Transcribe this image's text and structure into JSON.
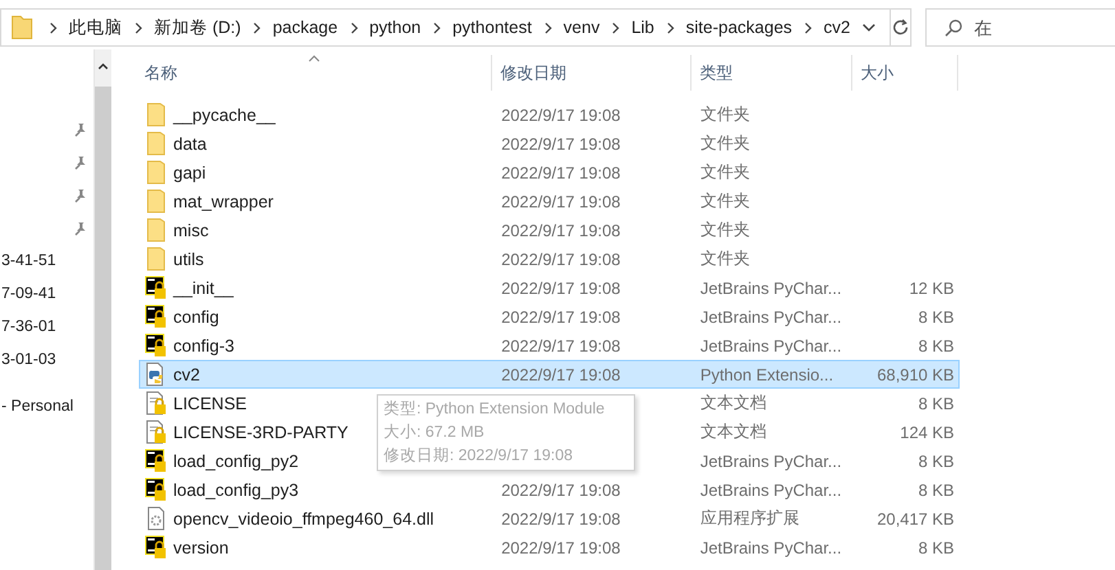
{
  "address_bar": {
    "path": [
      "此电脑",
      "新加卷 (D:)",
      "package",
      "python",
      "pythontest",
      "venv",
      "Lib",
      "site-packages",
      "cv2"
    ]
  },
  "search": {
    "placeholder": "在"
  },
  "sidebar": {
    "items": [
      {
        "label": "3-41-51"
      },
      {
        "label": "7-09-41"
      },
      {
        "label": "7-36-01"
      },
      {
        "label": "3-01-03"
      },
      {
        "label": "- Personal"
      }
    ]
  },
  "table": {
    "columns": [
      "名称",
      "修改日期",
      "类型",
      "大小"
    ],
    "rows": [
      {
        "kind": "folder",
        "name": "__pycache__",
        "date": "2022/9/17 19:08",
        "type": "文件夹",
        "selected": false
      },
      {
        "kind": "folder",
        "name": "data",
        "date": "2022/9/17 19:08",
        "type": "文件夹",
        "selected": false
      },
      {
        "kind": "folder",
        "name": "gapi",
        "date": "2022/9/17 19:08",
        "type": "文件夹",
        "selected": false
      },
      {
        "kind": "folder",
        "name": "mat_wrapper",
        "date": "2022/9/17 19:08",
        "type": "文件夹",
        "selected": false
      },
      {
        "kind": "folder",
        "name": "misc",
        "date": "2022/9/17 19:08",
        "type": "文件夹",
        "selected": false
      },
      {
        "kind": "folder",
        "name": "utils",
        "date": "2022/9/17 19:08",
        "type": "文件夹",
        "selected": false
      },
      {
        "kind": "pycharm",
        "name": "__init__",
        "date": "2022/9/17 19:08",
        "type": "JetBrains PyChar...",
        "size": "12 KB",
        "selected": false
      },
      {
        "kind": "pycharm",
        "name": "config",
        "date": "2022/9/17 19:08",
        "type": "JetBrains PyChar...",
        "size": "8 KB",
        "selected": false
      },
      {
        "kind": "pycharm",
        "name": "config-3",
        "date": "2022/9/17 19:08",
        "type": "JetBrains PyChar...",
        "size": "8 KB",
        "selected": false
      },
      {
        "kind": "python",
        "name": "cv2",
        "date": "2022/9/17 19:08",
        "type": "Python Extensio...",
        "size": "68,910 KB",
        "selected": true
      },
      {
        "kind": "text",
        "name": "LICENSE",
        "type": "文本文档",
        "size": "8 KB",
        "selected": false
      },
      {
        "kind": "text",
        "name": "LICENSE-3RD-PARTY",
        "type": "文本文档",
        "size": "124 KB",
        "selected": false
      },
      {
        "kind": "pycharm",
        "name": "load_config_py2",
        "type": "JetBrains PyChar...",
        "size": "8 KB",
        "selected": false
      },
      {
        "kind": "pycharm",
        "name": "load_config_py3",
        "date": "2022/9/17 19:08",
        "type": "JetBrains PyChar...",
        "size": "8 KB",
        "selected": false
      },
      {
        "kind": "dll",
        "name": "opencv_videoio_ffmpeg460_64.dll",
        "date": "2022/9/17 19:08",
        "type": "应用程序扩展",
        "size": "20,417 KB",
        "selected": false
      },
      {
        "kind": "pycharm",
        "name": "version",
        "date": "2022/9/17 19:08",
        "type": "JetBrains PyChar...",
        "size": "8 KB",
        "selected": false
      }
    ]
  },
  "tooltip": {
    "lines": [
      "类型: Python Extension Module",
      "大小: 67.2 MB",
      "修改日期: 2022/9/17 19:08"
    ]
  }
}
